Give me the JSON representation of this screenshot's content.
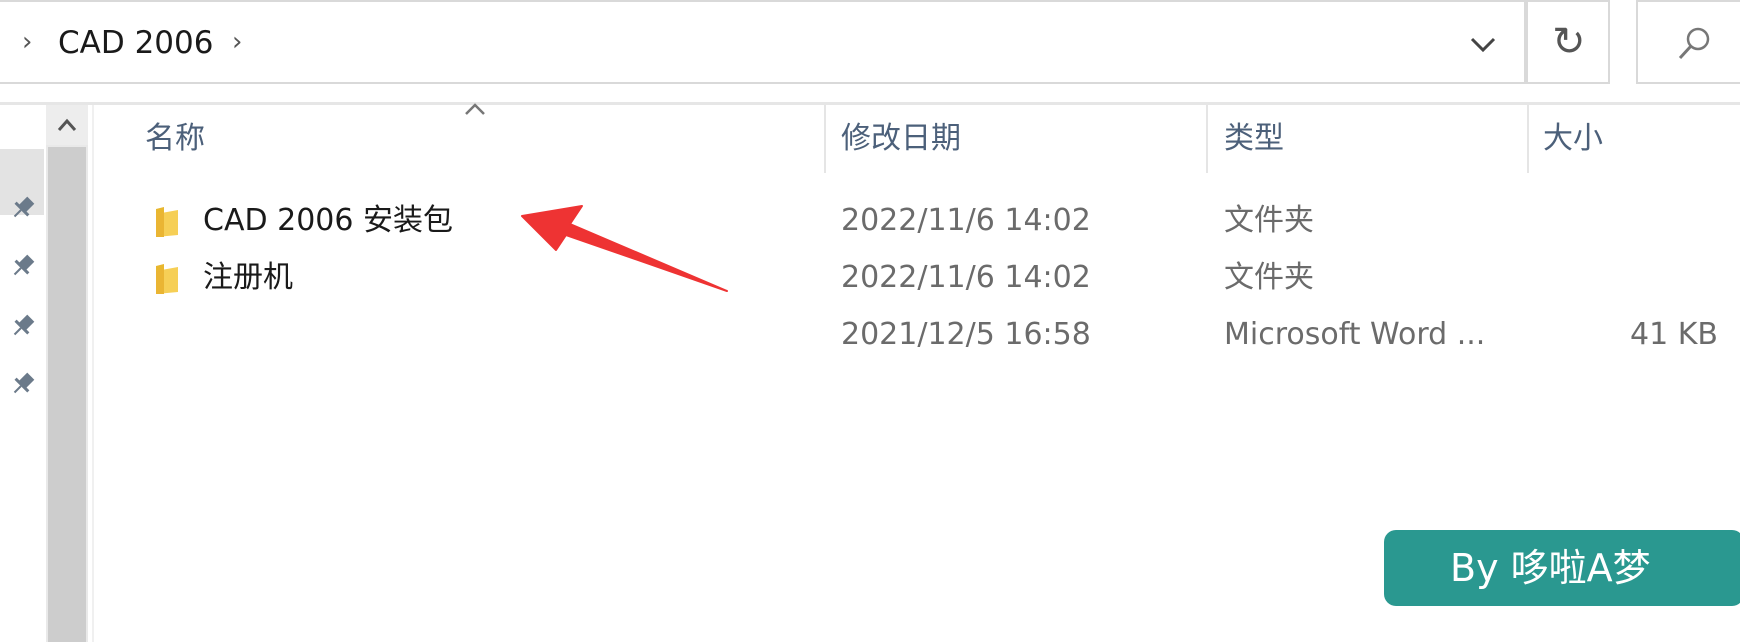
{
  "address_bar": {
    "breadcrumb": [
      "CAD 2006"
    ],
    "refresh_icon": "refresh-icon",
    "search_icon": "search-icon"
  },
  "columns": [
    {
      "label": "名称"
    },
    {
      "label": "修改日期"
    },
    {
      "label": "类型"
    },
    {
      "label": "大小"
    }
  ],
  "files": [
    {
      "name": "CAD 2006 安装包",
      "modified": "2022/11/6 14:02",
      "type": "文件夹",
      "size": "",
      "icon": "folder-icon"
    },
    {
      "name": "注册机",
      "modified": "2022/11/6 14:02",
      "type": "文件夹",
      "size": "",
      "icon": "folder-icon"
    },
    {
      "name": "",
      "modified": "2021/12/5 16:58",
      "type": "Microsoft Word ...",
      "size": "41 KB",
      "icon": ""
    }
  ],
  "annotation": {
    "color": "#ee3333"
  },
  "watermark": {
    "text": "By 哆啦A梦",
    "color": "#2a9890"
  }
}
